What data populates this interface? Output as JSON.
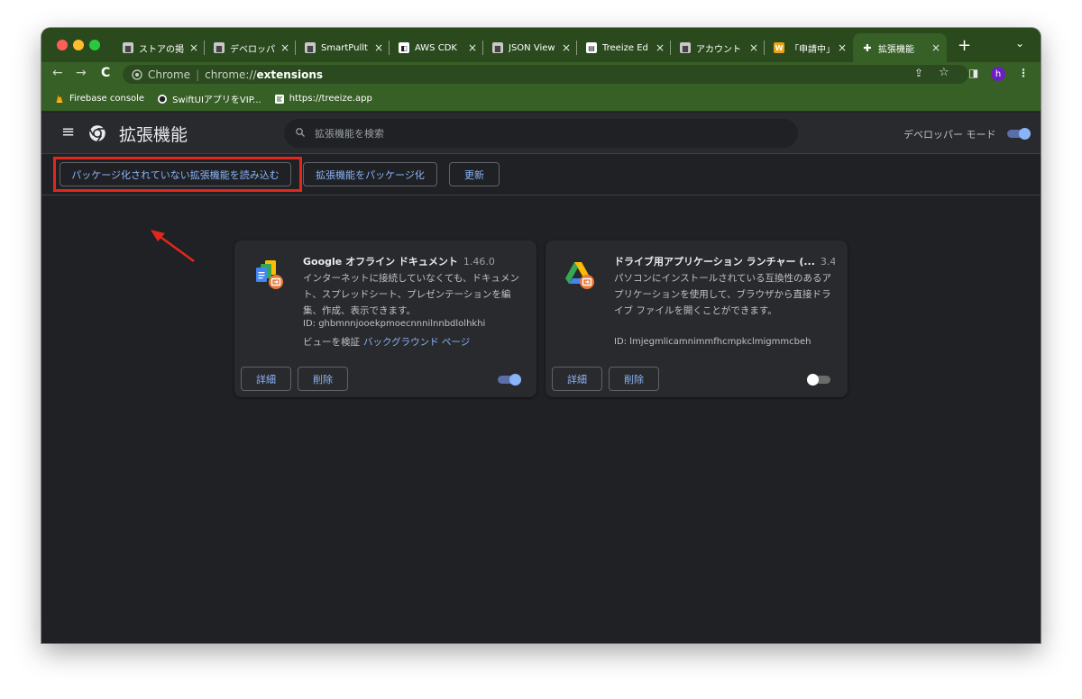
{
  "window": {
    "controls": [
      "close",
      "minimize",
      "zoom"
    ]
  },
  "tabs": [
    {
      "title": "ストアの掲",
      "favicon": "store-icon",
      "favcolor": "#d0d0d0",
      "glyph": "▆"
    },
    {
      "title": "デベロッパ",
      "favicon": "store-icon",
      "favcolor": "#d0d0d0",
      "glyph": "▆"
    },
    {
      "title": "SmartPullt",
      "favicon": "store-icon",
      "favcolor": "#d0d0d0",
      "glyph": "▆"
    },
    {
      "title": "AWS CDK",
      "favicon": "aws-icon",
      "favcolor": "#ffffff",
      "glyph": "◧"
    },
    {
      "title": "JSON View",
      "favicon": "store-icon",
      "favcolor": "#d0d0d0",
      "glyph": "▆"
    },
    {
      "title": "Treeize Ed",
      "favicon": "treeize-icon",
      "favcolor": "#ffffff",
      "glyph": "▤"
    },
    {
      "title": "アカウント",
      "favicon": "store-icon",
      "favcolor": "#d0d0d0",
      "glyph": "▆"
    },
    {
      "title": "「申請中」",
      "favicon": "w-icon",
      "favcolor": "#e8a317",
      "glyph": "W"
    },
    {
      "title": "拡張機能",
      "favicon": "puzzle-icon",
      "favcolor": "#ffffff",
      "glyph": "✚",
      "active": true
    }
  ],
  "tab_close": "×",
  "new_tab": "+",
  "tab_menu": "⌄",
  "toolbar": {
    "back": "←",
    "forward": "→",
    "reload": "C",
    "chip_label": "Chrome",
    "url_scheme": "chrome://",
    "url_host": "extensions",
    "share": "⇪",
    "star": "☆",
    "sidepanel": "◨",
    "avatar": "h",
    "menu": "⋮"
  },
  "bookmarks": [
    {
      "label": "Firebase console",
      "icon": "firebase-icon"
    },
    {
      "label": "SwiftUIアプリをVIP...",
      "icon": "github-icon"
    },
    {
      "label": "https://treeize.app",
      "icon": "treeize-icon"
    }
  ],
  "header": {
    "menu": "≡",
    "title": "拡張機能",
    "search_placeholder": "拡張機能を検索",
    "devmode_label": "デベロッパー モード",
    "devmode_on": true
  },
  "actions": {
    "load_unpacked": "パッケージ化されていない拡張機能を読み込む",
    "pack": "拡張機能をパッケージ化",
    "update": "更新"
  },
  "extensions": [
    {
      "name": "Google オフライン ドキュメント",
      "version": "1.46.0",
      "description": "インターネットに接続していなくても、ドキュメント、スプレッドシート、プレゼンテーションを編集、作成、表示できます。",
      "id": "ID: ghbmnnjooekpmoecnnnilnnbdlolhkhi",
      "inspect_label": "ビューを検証",
      "inspect_link": "バックグラウンド ページ",
      "details": "詳細",
      "remove": "削除",
      "enabled": true
    },
    {
      "name": "ドライブ用アプリケーション ランチャー (...",
      "version": "3.4",
      "description": "パソコンにインストールされている互換性のあるアプリケーションを使用して、ブラウザから直接ドライブ ファイルを開くことができます。",
      "id": "ID: lmjegmlicamnimmfhcmpkclmigmmcbeh",
      "details": "詳細",
      "remove": "削除",
      "enabled": false
    }
  ],
  "colors": {
    "highlight": "#e3271d",
    "accent": "#8ab4f8",
    "tabstrip": "#2a4a1e",
    "toolbar": "#376026"
  }
}
